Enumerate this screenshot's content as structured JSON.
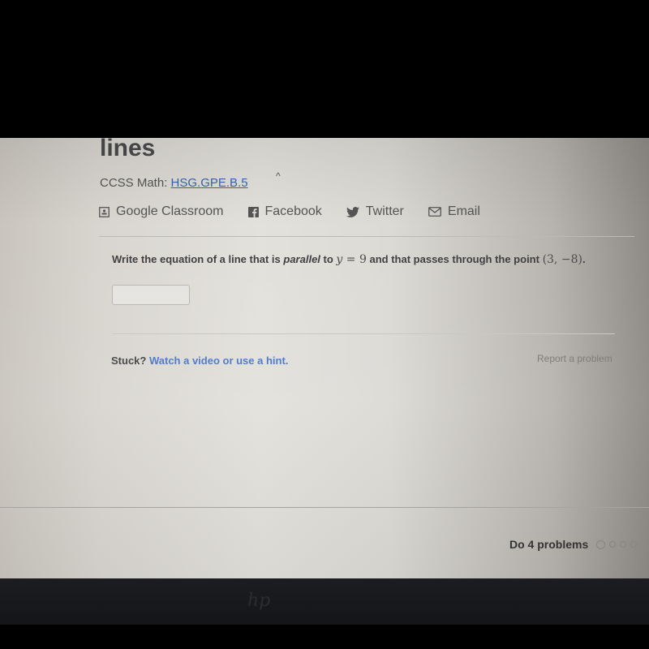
{
  "page": {
    "title": "lines",
    "standard_label": "CCSS Math:",
    "standard_link": "HSG.GPE.B.5",
    "collapse_glyph": "^"
  },
  "share": [
    {
      "label": "Google Classroom",
      "icon": "google-classroom-icon"
    },
    {
      "label": "Facebook",
      "icon": "facebook-icon"
    },
    {
      "label": "Twitter",
      "icon": "twitter-icon"
    },
    {
      "label": "Email",
      "icon": "email-icon"
    }
  ],
  "question": {
    "prefix": "Write the equation of a line that is ",
    "emphasis": "parallel",
    "middle": " to ",
    "equation_var": "y",
    "equation_rest": " = 9",
    "suffix": " and that passes through the point ",
    "point": "(3, −8)",
    "end": "."
  },
  "answer": {
    "value": "",
    "placeholder": ""
  },
  "help": {
    "stuck_label": "Stuck?",
    "hint_link": "Watch a video or use a hint.",
    "report_link": "Report a problem"
  },
  "progress": {
    "label": "Do 4 problems",
    "total": 4,
    "completed": 0
  },
  "device": {
    "logo": "hp"
  },
  "colors": {
    "link": "#3a64b0",
    "hint_link": "#4a78c9",
    "text": "#3e3e40"
  }
}
